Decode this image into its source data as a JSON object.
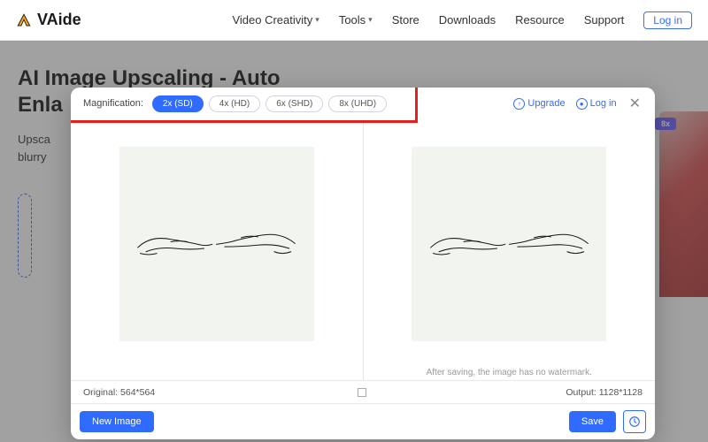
{
  "brand": "VAide",
  "nav": {
    "items": [
      "Video Creativity",
      "Tools",
      "Store",
      "Downloads",
      "Resource",
      "Support"
    ],
    "login": "Log in"
  },
  "page": {
    "title": "AI Image Upscaling - Auto Enla",
    "desc": "Upsca blurry"
  },
  "side_badge": "8x",
  "modal": {
    "mag_label": "Magnification:",
    "options": [
      {
        "label": "2x (SD)",
        "active": true
      },
      {
        "label": "4x (HD)",
        "active": false
      },
      {
        "label": "6x (SHD)",
        "active": false
      },
      {
        "label": "8x (UHD)",
        "active": false
      }
    ],
    "upgrade": "Upgrade",
    "login": "Log in",
    "note_right": "After saving, the image has no watermark.",
    "original_label": "Original: 564*564",
    "output_label": "Output: 1128*1128",
    "new_image": "New Image",
    "save": "Save"
  }
}
